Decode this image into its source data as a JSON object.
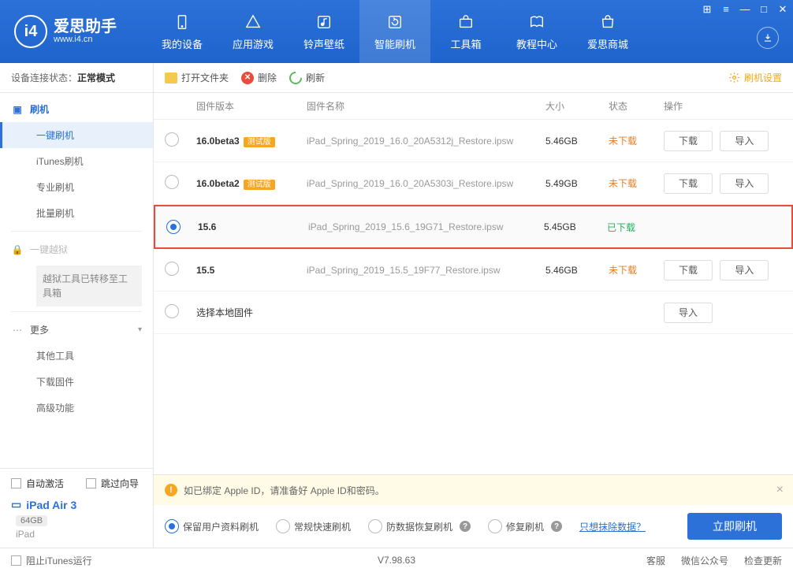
{
  "header": {
    "app_name": "爱思助手",
    "app_url": "www.i4.cn",
    "nav": [
      {
        "label": "我的设备"
      },
      {
        "label": "应用游戏"
      },
      {
        "label": "铃声壁纸"
      },
      {
        "label": "智能刷机"
      },
      {
        "label": "工具箱"
      },
      {
        "label": "教程中心"
      },
      {
        "label": "爱思商城"
      }
    ]
  },
  "sidebar": {
    "status_label": "设备连接状态：",
    "status_value": "正常模式",
    "groups": {
      "flash": "刷机",
      "jailbreak": "一键越狱",
      "more": "更多"
    },
    "flash_items": [
      "一键刷机",
      "iTunes刷机",
      "专业刷机",
      "批量刷机"
    ],
    "jailbreak_note": "越狱工具已转移至工具箱",
    "more_items": [
      "其他工具",
      "下载固件",
      "高级功能"
    ],
    "auto_activate": "自动激活",
    "skip_guide": "跳过向导",
    "device_name": "iPad Air 3",
    "device_storage": "64GB",
    "device_type": "iPad"
  },
  "toolbar": {
    "open_folder": "打开文件夹",
    "delete": "删除",
    "refresh": "刷新",
    "settings": "刷机设置"
  },
  "table": {
    "headers": {
      "version": "固件版本",
      "name": "固件名称",
      "size": "大小",
      "status": "状态",
      "ops": "操作"
    },
    "rows": [
      {
        "version": "16.0beta3",
        "beta": "测试版",
        "name": "iPad_Spring_2019_16.0_20A5312j_Restore.ipsw",
        "size": "5.46GB",
        "status": "未下载",
        "selected": false,
        "downloaded": false
      },
      {
        "version": "16.0beta2",
        "beta": "测试版",
        "name": "iPad_Spring_2019_16.0_20A5303i_Restore.ipsw",
        "size": "5.49GB",
        "status": "未下载",
        "selected": false,
        "downloaded": false
      },
      {
        "version": "15.6",
        "beta": "",
        "name": "iPad_Spring_2019_15.6_19G71_Restore.ipsw",
        "size": "5.45GB",
        "status": "已下载",
        "selected": true,
        "downloaded": true
      },
      {
        "version": "15.5",
        "beta": "",
        "name": "iPad_Spring_2019_15.5_19F77_Restore.ipsw",
        "size": "5.46GB",
        "status": "未下载",
        "selected": false,
        "downloaded": false
      }
    ],
    "local_row": "选择本地固件",
    "btn_download": "下载",
    "btn_import": "导入"
  },
  "warning": "如已绑定 Apple ID，请准备好 Apple ID和密码。",
  "options": {
    "opt1": "保留用户资料刷机",
    "opt2": "常规快速刷机",
    "opt3": "防数据恢复刷机",
    "opt4": "修复刷机",
    "link": "只想抹除数据？",
    "flash_btn": "立即刷机"
  },
  "footer": {
    "block_itunes": "阻止iTunes运行",
    "version": "V7.98.63",
    "links": [
      "客服",
      "微信公众号",
      "检查更新"
    ]
  }
}
